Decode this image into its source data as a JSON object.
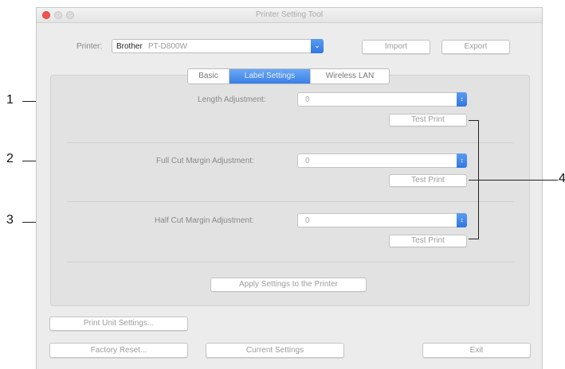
{
  "window": {
    "title": "Printer Setting Tool"
  },
  "printer": {
    "label": "Printer:",
    "value_brand": "Brother",
    "value_model": "PT-D800W"
  },
  "top_buttons": {
    "import": "Import",
    "export": "Export"
  },
  "tabs": [
    {
      "label": "Basic",
      "active": false
    },
    {
      "label": "Label Settings",
      "active": true
    },
    {
      "label": "Wireless LAN",
      "active": false
    }
  ],
  "settings": [
    {
      "label": "Length Adjustment:",
      "value": "0",
      "test_print": "Test Print"
    },
    {
      "label": "Full Cut Margin Adjustment:",
      "value": "0",
      "test_print": "Test Print"
    },
    {
      "label": "Half Cut Margin Adjustment:",
      "value": "0",
      "test_print": "Test Print"
    }
  ],
  "apply_button": "Apply Settings to the Printer",
  "bottom_buttons": {
    "print_unit": "Print Unit Settings...",
    "factory_reset": "Factory Reset...",
    "current_settings": "Current Settings",
    "exit": "Exit"
  },
  "callouts": {
    "c1": "1",
    "c2": "2",
    "c3": "3",
    "c4": "4"
  },
  "icons": {
    "dropdown": "chevron-updown-icon",
    "printer_dropdown": "chevron-down-icon"
  },
  "colors": {
    "accent": "#3a80e6",
    "close_light": "#f0564d"
  }
}
